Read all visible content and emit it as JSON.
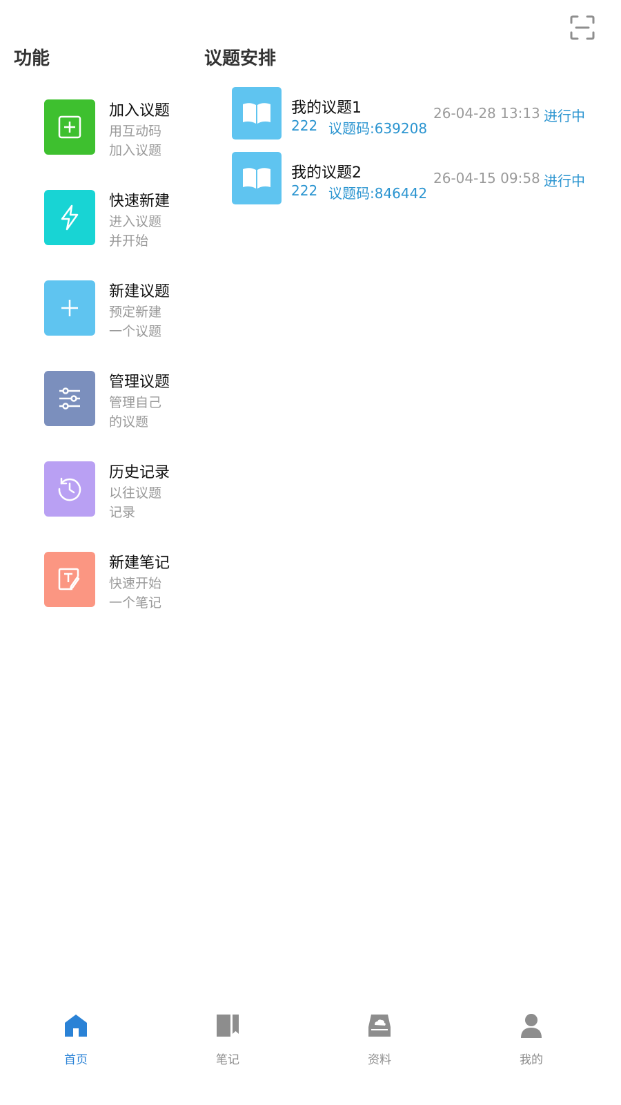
{
  "header": {
    "scan_icon": "scan-icon"
  },
  "features": {
    "title": "功能",
    "items": [
      {
        "title": "加入议题",
        "desc": "用互动码加入议题",
        "icon": "plus-square-icon",
        "color": "#3ec02f"
      },
      {
        "title": "快速新建",
        "desc": "进入议题并开始",
        "icon": "lightning-icon",
        "color": "#18d4d4"
      },
      {
        "title": "新建议题",
        "desc": "预定新建一个议题",
        "icon": "plus-icon",
        "color": "#5fc4f0"
      },
      {
        "title": "管理议题",
        "desc": "管理自己的议题",
        "icon": "sliders-icon",
        "color": "#7b8fbd"
      },
      {
        "title": "历史记录",
        "desc": "以往议题记录",
        "icon": "history-icon",
        "color": "#b9a0f3"
      },
      {
        "title": "新建笔记",
        "desc": "快速开始一个笔记",
        "icon": "note-edit-icon",
        "color": "#fb9682"
      }
    ]
  },
  "agenda": {
    "title": "议题安排",
    "items": [
      {
        "name": "我的议题1",
        "count": "222",
        "code": "议题码:639208",
        "time": "26-04-28 13:13",
        "status": "进行中",
        "icon": "book-icon"
      },
      {
        "name": "我的议题2",
        "count": "222",
        "code": "议题码:846442",
        "time": "26-04-15 09:58",
        "status": "进行中",
        "icon": "book-icon"
      }
    ]
  },
  "colors": {
    "accent": "#2a94d0",
    "tab_active": "#2a82d6",
    "tab_inactive": "#8d8d8d",
    "book_cover": "#5fc4f0"
  },
  "tabbar": {
    "tabs": [
      {
        "label": "首页",
        "icon": "home-icon",
        "active": true
      },
      {
        "label": "笔记",
        "icon": "notebook-icon",
        "active": false
      },
      {
        "label": "资料",
        "icon": "cloud-drive-icon",
        "active": false
      },
      {
        "label": "我的",
        "icon": "user-icon",
        "active": false
      }
    ]
  }
}
